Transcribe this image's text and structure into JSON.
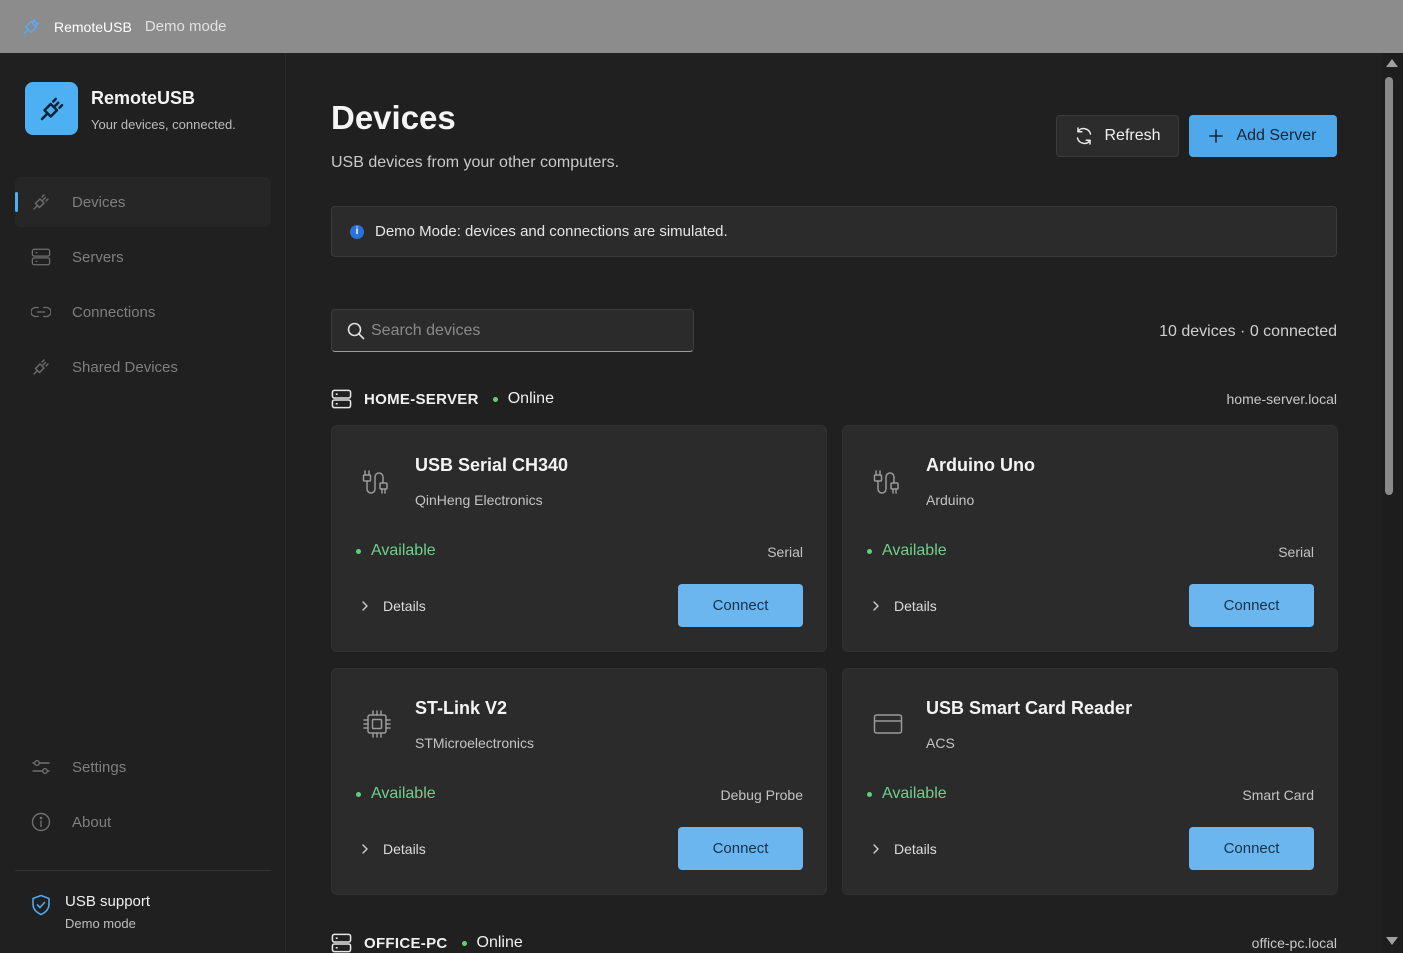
{
  "titlebar": {
    "app_name": "RemoteUSB",
    "mode": "Demo mode",
    "icon": "plug-icon"
  },
  "brand": {
    "title": "RemoteUSB",
    "subtitle": "Your devices, connected."
  },
  "nav": {
    "items": [
      {
        "label": "Devices",
        "icon": "plug-icon",
        "active": true
      },
      {
        "label": "Servers",
        "icon": "server-icon"
      },
      {
        "label": "Connections",
        "icon": "link-icon"
      },
      {
        "label": "Shared Devices",
        "icon": "plug-icon"
      }
    ],
    "bottom": [
      {
        "label": "Settings",
        "icon": "sliders-icon"
      },
      {
        "label": "About",
        "icon": "info-icon"
      }
    ]
  },
  "support": {
    "title": "USB support",
    "subtitle": "Demo mode"
  },
  "page": {
    "title": "Devices",
    "subtitle": "USB devices from your other computers."
  },
  "toolbar": {
    "refresh_label": "Refresh",
    "add_server_label": "Add Server"
  },
  "info": {
    "text": "Demo Mode: devices and connections are simulated.",
    "icon_glyph": "i"
  },
  "search": {
    "placeholder": "Search devices",
    "value": ""
  },
  "count": "10 devices · 0 connected",
  "servers": [
    {
      "name": "HOME-SERVER",
      "status": "Online",
      "host": "home-server.local",
      "devices": [
        {
          "name": "USB Serial CH340",
          "vendor": "QinHeng Electronics",
          "status": "Available",
          "type": "Serial",
          "icon": "usb-plug-icon",
          "details_label": "Details",
          "connect_label": "Connect"
        },
        {
          "name": "Arduino Uno",
          "vendor": "Arduino",
          "status": "Available",
          "type": "Serial",
          "icon": "usb-plug-icon",
          "details_label": "Details",
          "connect_label": "Connect"
        },
        {
          "name": "ST-Link V2",
          "vendor": "STMicroelectronics",
          "status": "Available",
          "type": "Debug Probe",
          "icon": "chip-icon",
          "details_label": "Details",
          "connect_label": "Connect"
        },
        {
          "name": "USB Smart Card Reader",
          "vendor": "ACS",
          "status": "Available",
          "type": "Smart Card",
          "icon": "card-icon",
          "details_label": "Details",
          "connect_label": "Connect"
        }
      ]
    },
    {
      "name": "OFFICE-PC",
      "status": "Online",
      "host": "office-pc.local",
      "devices": []
    }
  ],
  "colors": {
    "accent": "#4cb0f2",
    "button": "#6bb6ee",
    "status_green": "#5dd17a"
  }
}
